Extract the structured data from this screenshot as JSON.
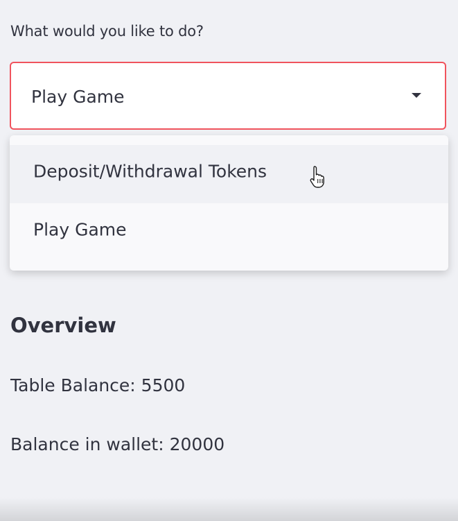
{
  "prompt": {
    "label": "What would you like to do?"
  },
  "select": {
    "value": "Play Game",
    "options": [
      "Deposit/Withdrawal Tokens",
      "Play Game"
    ],
    "accent_color": "#f0535d"
  },
  "overview": {
    "heading": "Overview",
    "table_balance": "Table Balance: 5500",
    "wallet_balance": "Balance in wallet: 20000"
  },
  "icons": {
    "dropdown": "chevron-down-icon",
    "cursor": "hand-pointer-cursor-icon"
  }
}
